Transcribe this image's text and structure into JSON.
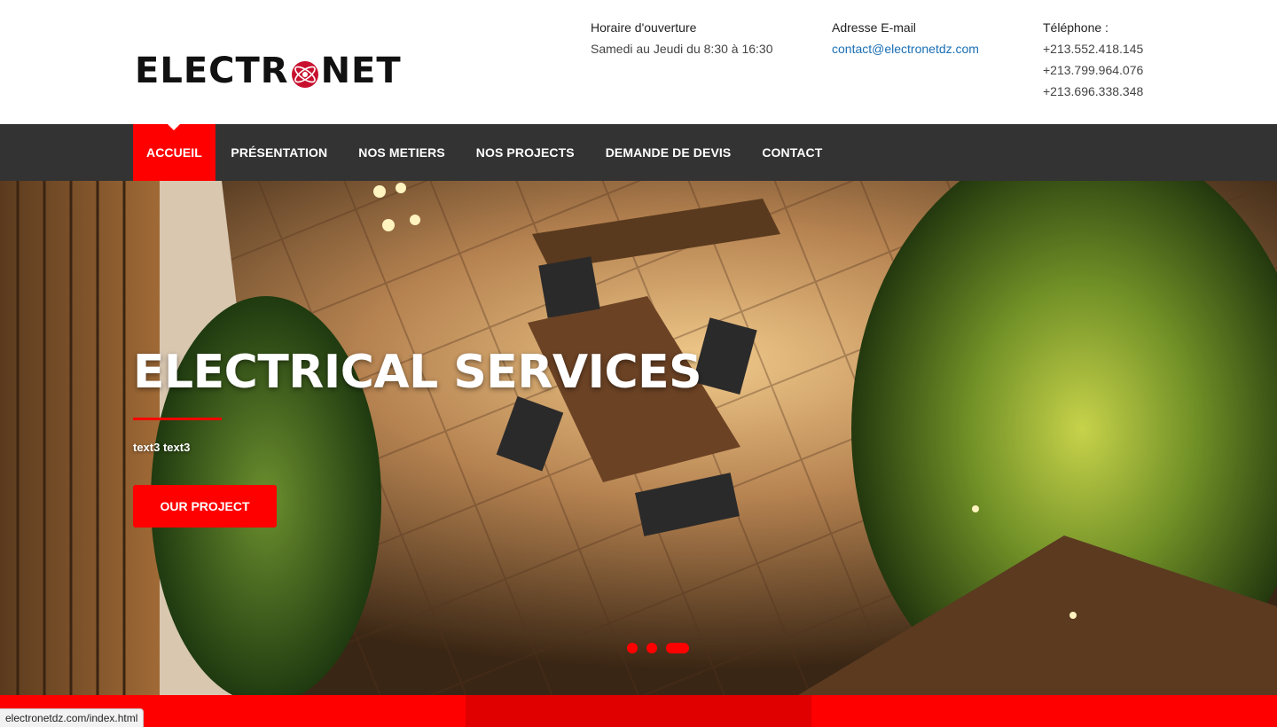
{
  "header": {
    "logo_text_left": "ELECTR",
    "logo_text_right": "NET",
    "hours": {
      "title": "Horaire d'ouverture",
      "value": "Samedi au Jeudi du 8:30 à 16:30"
    },
    "email": {
      "title": "Adresse E-mail",
      "value": "contact@electronetdz.com"
    },
    "phone": {
      "title": "Téléphone :",
      "numbers": [
        "+213.552.418.145",
        "+213.799.964.076",
        "+213.696.338.348"
      ]
    }
  },
  "nav": {
    "items": [
      {
        "label": "ACCUEIL",
        "active": true
      },
      {
        "label": "PRÉSENTATION",
        "active": false
      },
      {
        "label": "NOS METIERS",
        "active": false
      },
      {
        "label": "NOS PROJECTS",
        "active": false
      },
      {
        "label": "DEMANDE DE DEVIS",
        "active": false
      },
      {
        "label": "CONTACT",
        "active": false
      }
    ]
  },
  "hero": {
    "title": "ELECTRICAL SERVICES",
    "subtitle": "text3 text3",
    "button_label": "OUR PROJECT",
    "slides": 3,
    "active_slide": 3
  },
  "status_bar": {
    "url": "electronetdz.com/index.html"
  },
  "colors": {
    "accent": "#ff0000",
    "nav_bg": "#333333",
    "link": "#1a6fb5"
  }
}
